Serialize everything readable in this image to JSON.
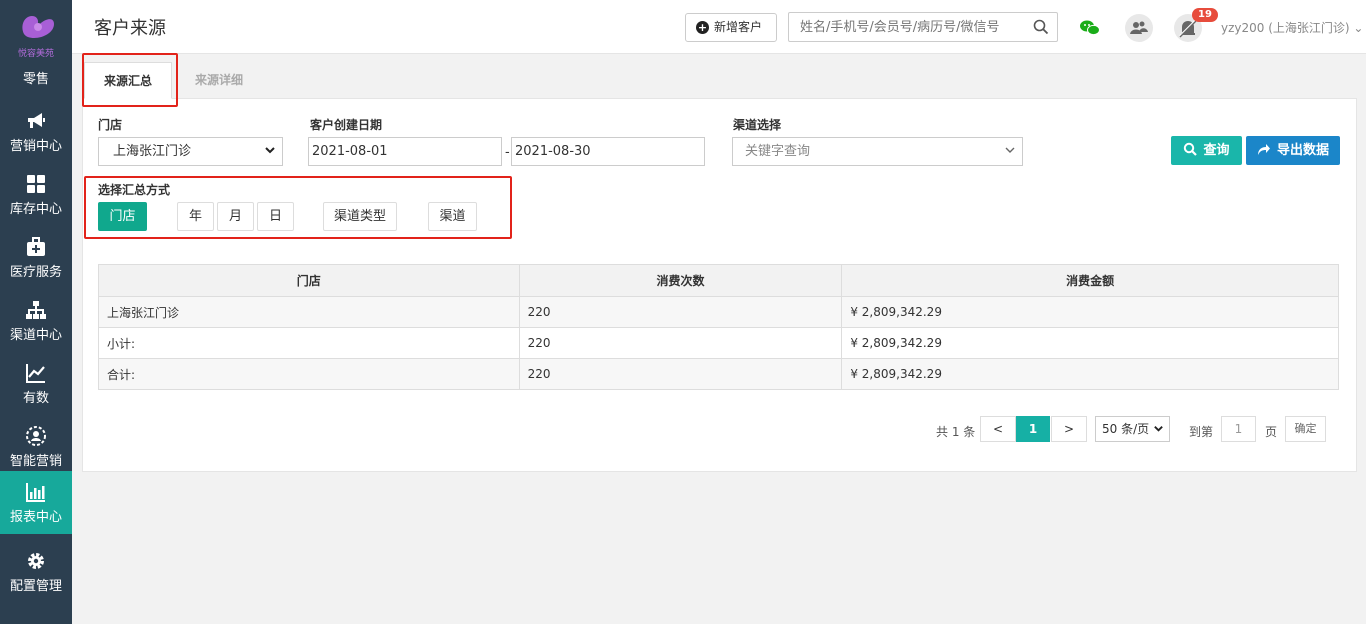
{
  "sidebar": {
    "logo_text": "悦容美苑",
    "first_label": "零售",
    "items": [
      {
        "label": "营销中心",
        "icon": "megaphone-icon"
      },
      {
        "label": "库存中心",
        "icon": "grid-icon"
      },
      {
        "label": "医疗服务",
        "icon": "medical-kit-icon"
      },
      {
        "label": "渠道中心",
        "icon": "sitemap-icon"
      },
      {
        "label": "有数",
        "icon": "line-chart-icon"
      },
      {
        "label": "智能营销",
        "icon": "user-cog-icon"
      },
      {
        "label": "报表中心",
        "icon": "bar-chart-icon",
        "active": true
      },
      {
        "label": "配置管理",
        "icon": "gear-icon"
      }
    ]
  },
  "header": {
    "title": "客户来源",
    "new_customer_label": "新增客户",
    "search_placeholder": "姓名/手机号/会员号/病历号/微信号",
    "notification_count": "19",
    "user": "yzy200 (上海张江门诊)"
  },
  "tabs": [
    {
      "label": "来源汇总",
      "active": true
    },
    {
      "label": "来源详细",
      "active": false
    }
  ],
  "filters": {
    "store_label": "门店",
    "store_value": "上海张江门诊",
    "date_label": "客户创建日期",
    "date_from": "2021-08-01",
    "date_sep": "-",
    "date_to": "2021-08-30",
    "channel_label": "渠道选择",
    "channel_placeholder": "关键字查询",
    "query_label": "查询",
    "export_label": "导出数据"
  },
  "summary_mode": {
    "label": "选择汇总方式",
    "options": [
      {
        "label": "门店",
        "active": true
      },
      {
        "label": "年",
        "active": false
      },
      {
        "label": "月",
        "active": false
      },
      {
        "label": "日",
        "active": false
      },
      {
        "label": "渠道类型",
        "active": false
      },
      {
        "label": "渠道",
        "active": false
      }
    ]
  },
  "table": {
    "columns": [
      "门店",
      "消费次数",
      "消费金额"
    ],
    "rows": [
      [
        "上海张江门诊",
        "220",
        "¥ 2,809,342.29"
      ],
      [
        "小计:",
        "220",
        "¥ 2,809,342.29"
      ],
      [
        "合计:",
        "220",
        "¥ 2,809,342.29"
      ]
    ]
  },
  "pagination": {
    "total_text": "共 1 条",
    "prev": "<",
    "current": "1",
    "next": ">",
    "page_size": "50 条/页",
    "goto_label": "到第",
    "goto_value": "1",
    "page_unit": "页",
    "confirm": "确定"
  },
  "colors": {
    "sidebar_bg": "#2c3f50",
    "accent": "#17a99b",
    "export_blue": "#1b86c9",
    "highlight_red": "#e2231a"
  }
}
